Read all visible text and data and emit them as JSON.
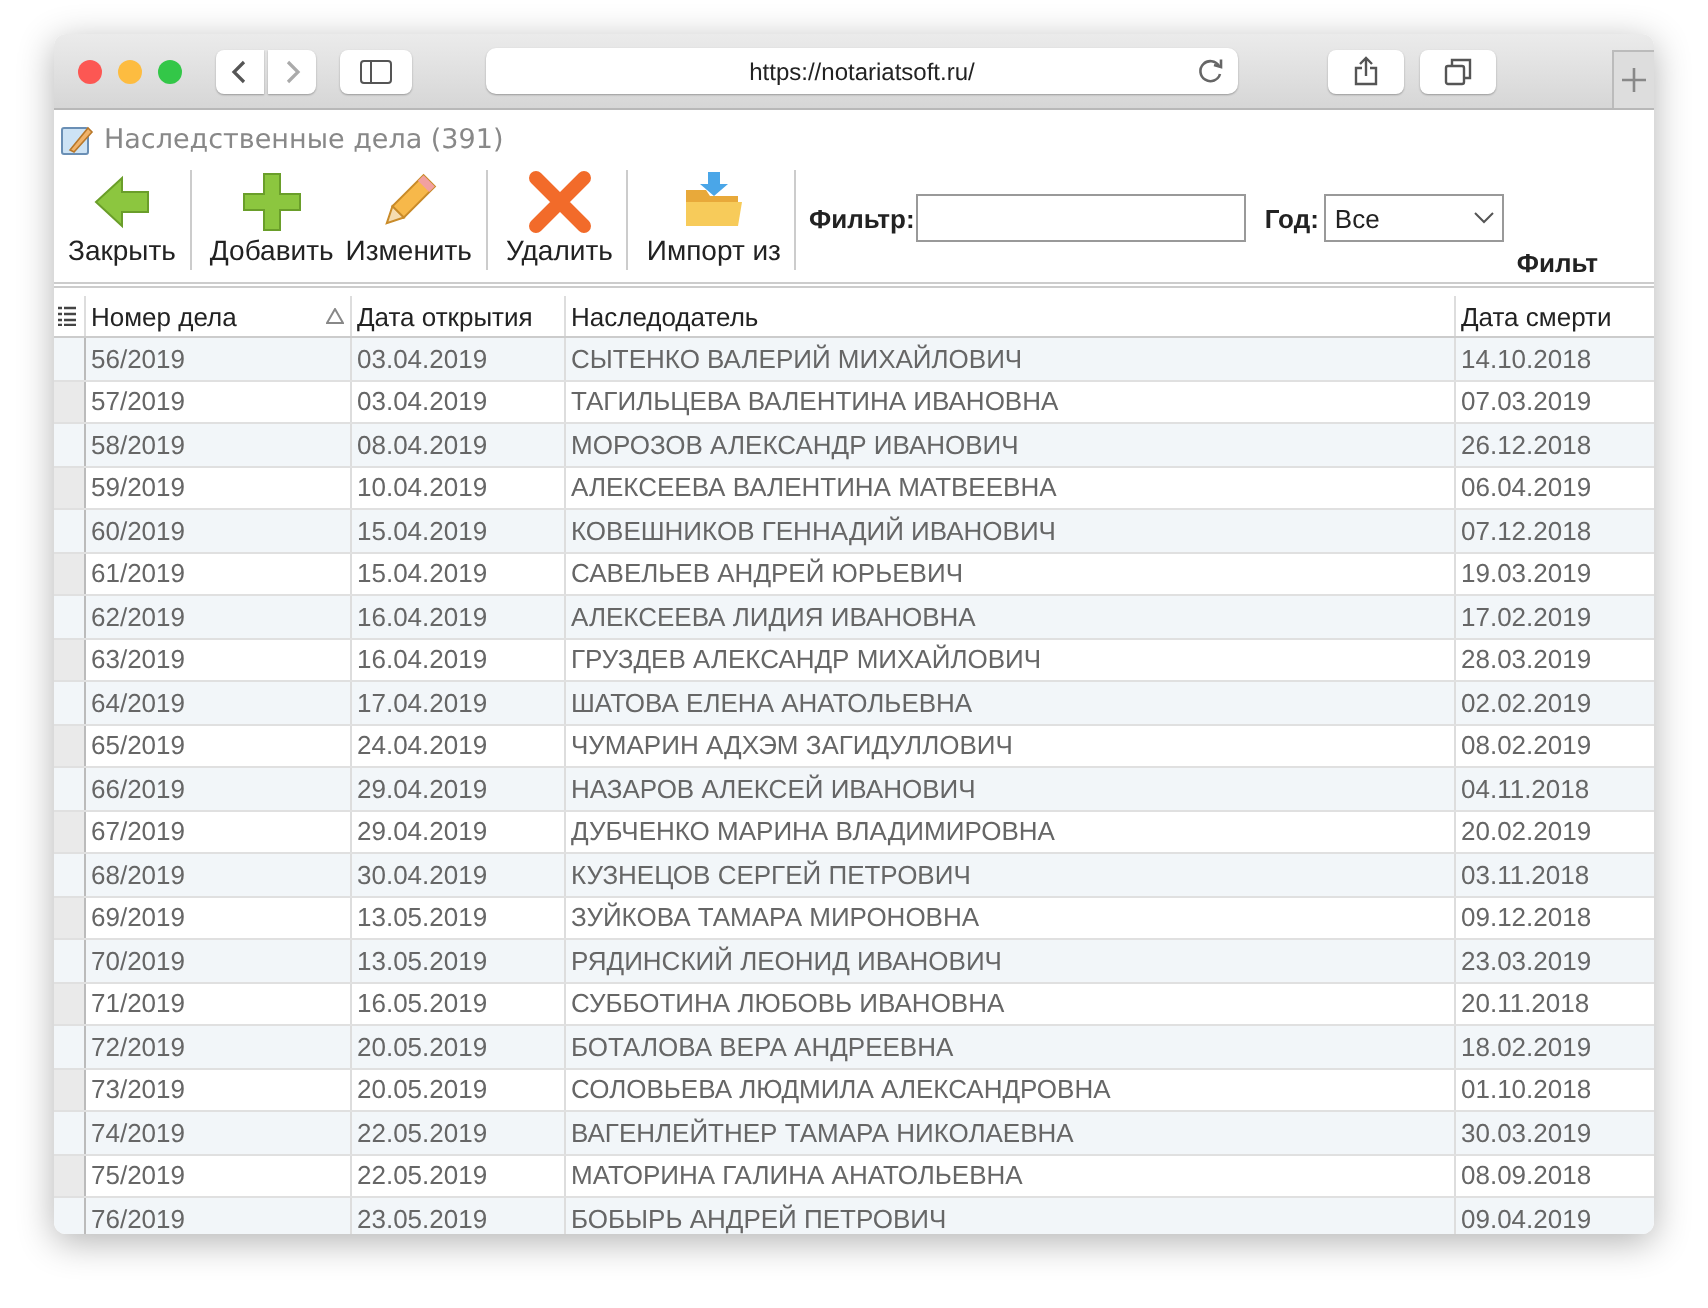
{
  "browser": {
    "url": "https://notariatsoft.ru/"
  },
  "app": {
    "title": "Наследственные дела (391)"
  },
  "toolbar": {
    "groups": [
      {
        "buttons": [
          {
            "label": "Закрыть"
          }
        ]
      },
      {
        "buttons": [
          {
            "label": "Добавить"
          },
          {
            "label": "Изменить"
          }
        ]
      },
      {
        "buttons": [
          {
            "label": "Удалить"
          }
        ]
      },
      {
        "buttons": [
          {
            "label": "Импорт из"
          }
        ]
      }
    ],
    "filter": {
      "label": "Фильтр:"
    },
    "year": {
      "label": "Год:",
      "value": "Все"
    },
    "extra_label": "Фильт"
  },
  "table": {
    "columns": [
      {
        "label": "Номер дела",
        "sorted": true
      },
      {
        "label": "Дата открытия",
        "sorted": false
      },
      {
        "label": "Наследодатель",
        "sorted": false
      },
      {
        "label": "Дата смерти",
        "sorted": false
      }
    ],
    "rows": [
      [
        "56/2019",
        "03.04.2019",
        "СЫТЕНКО ВАЛЕРИЙ МИХАЙЛОВИЧ",
        "14.10.2018"
      ],
      [
        "57/2019",
        "03.04.2019",
        "ТАГИЛЬЦЕВА ВАЛЕНТИНА ИВАНОВНА",
        "07.03.2019"
      ],
      [
        "58/2019",
        "08.04.2019",
        "МОРОЗОВ АЛЕКСАНДР ИВАНОВИЧ",
        "26.12.2018"
      ],
      [
        "59/2019",
        "10.04.2019",
        "АЛЕКСЕЕВА ВАЛЕНТИНА МАТВЕЕВНА",
        "06.04.2019"
      ],
      [
        "60/2019",
        "15.04.2019",
        "КОВЕШНИКОВ ГЕННАДИЙ ИВАНОВИЧ",
        "07.12.2018"
      ],
      [
        "61/2019",
        "15.04.2019",
        "САВЕЛЬЕВ АНДРЕЙ ЮРЬЕВИЧ",
        "19.03.2019"
      ],
      [
        "62/2019",
        "16.04.2019",
        "АЛЕКСЕЕВА ЛИДИЯ ИВАНОВНА",
        "17.02.2019"
      ],
      [
        "63/2019",
        "16.04.2019",
        "ГРУЗДЕВ АЛЕКСАНДР МИХАЙЛОВИЧ",
        "28.03.2019"
      ],
      [
        "64/2019",
        "17.04.2019",
        "ШАТОВА ЕЛЕНА АНАТОЛЬЕВНА",
        "02.02.2019"
      ],
      [
        "65/2019",
        "24.04.2019",
        "ЧУМАРИН АДХЭМ ЗАГИДУЛЛОВИЧ",
        "08.02.2019"
      ],
      [
        "66/2019",
        "29.04.2019",
        "НАЗАРОВ АЛЕКСЕЙ ИВАНОВИЧ",
        "04.11.2018"
      ],
      [
        "67/2019",
        "29.04.2019",
        "ДУБЧЕНКО МАРИНА ВЛАДИМИРОВНА",
        "20.02.2019"
      ],
      [
        "68/2019",
        "30.04.2019",
        "КУЗНЕЦОВ СЕРГЕЙ ПЕТРОВИЧ",
        "03.11.2018"
      ],
      [
        "69/2019",
        "13.05.2019",
        "ЗУЙКОВА ТАМАРА МИРОНОВНА",
        "09.12.2018"
      ],
      [
        "70/2019",
        "13.05.2019",
        "РЯДИНСКИЙ ЛЕОНИД ИВАНОВИЧ",
        "23.03.2019"
      ],
      [
        "71/2019",
        "16.05.2019",
        "СУББОТИНА ЛЮБОВЬ ИВАНОВНА",
        "20.11.2018"
      ],
      [
        "72/2019",
        "20.05.2019",
        "БОТАЛОВА ВЕРА АНДРЕЕВНА",
        "18.02.2019"
      ],
      [
        "73/2019",
        "20.05.2019",
        "СОЛОВЬЕВА ЛЮДМИЛА АЛЕКСАНДРОВНА",
        "01.10.2018"
      ],
      [
        "74/2019",
        "22.05.2019",
        "ВАГЕНЛЕЙТНЕР ТАМАРА НИКОЛАЕВНА",
        "30.03.2019"
      ],
      [
        "75/2019",
        "22.05.2019",
        "МАТОРИНА ГАЛИНА АНАТОЛЬЕВНА",
        "08.09.2018"
      ],
      [
        "76/2019",
        "23.05.2019",
        "БОБЫРЬ АНДРЕЙ ПЕТРОВИЧ",
        "09.04.2019"
      ]
    ]
  }
}
